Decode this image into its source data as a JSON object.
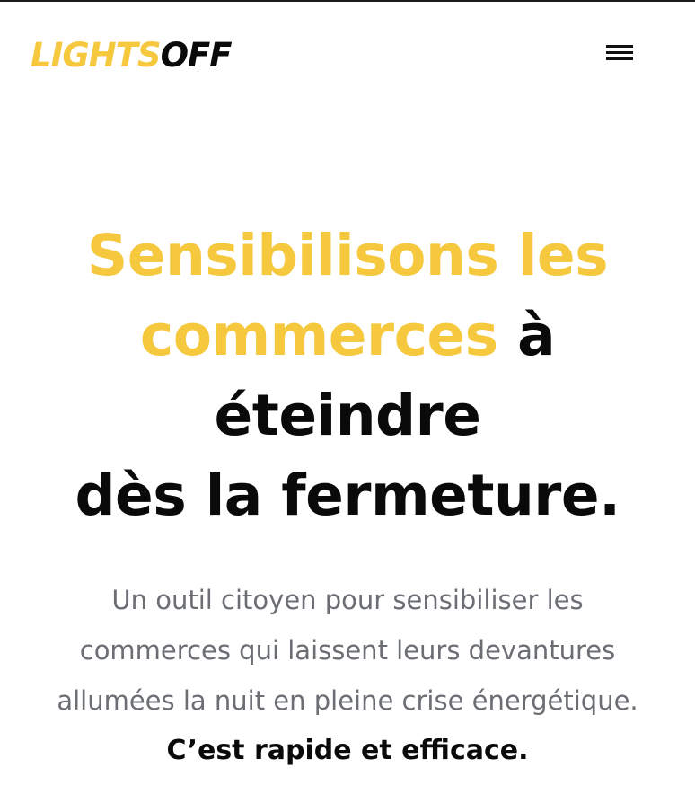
{
  "header": {
    "logo_part1": "LIGHTS",
    "logo_part2": "OFF",
    "menu_icon": "hamburger-menu-icon"
  },
  "hero": {
    "title_line1": "Sensibilisons les",
    "title_line2_highlight": "commerces",
    "title_line2_rest": " à",
    "title_line3": "éteindre",
    "title_line4": "dès la fermeture.",
    "subtitle_line1": "Un outil citoyen pour sensibiliser les",
    "subtitle_line2": "commerces qui laissent leurs devantures",
    "subtitle_line3": "allumées la nuit en pleine crise énergétique.",
    "cta": "C’est rapide et efficace."
  },
  "colors": {
    "accent": "#f5c83e",
    "text": "#0a0a0a",
    "muted": "#6b6e73",
    "background": "#ffffff"
  }
}
